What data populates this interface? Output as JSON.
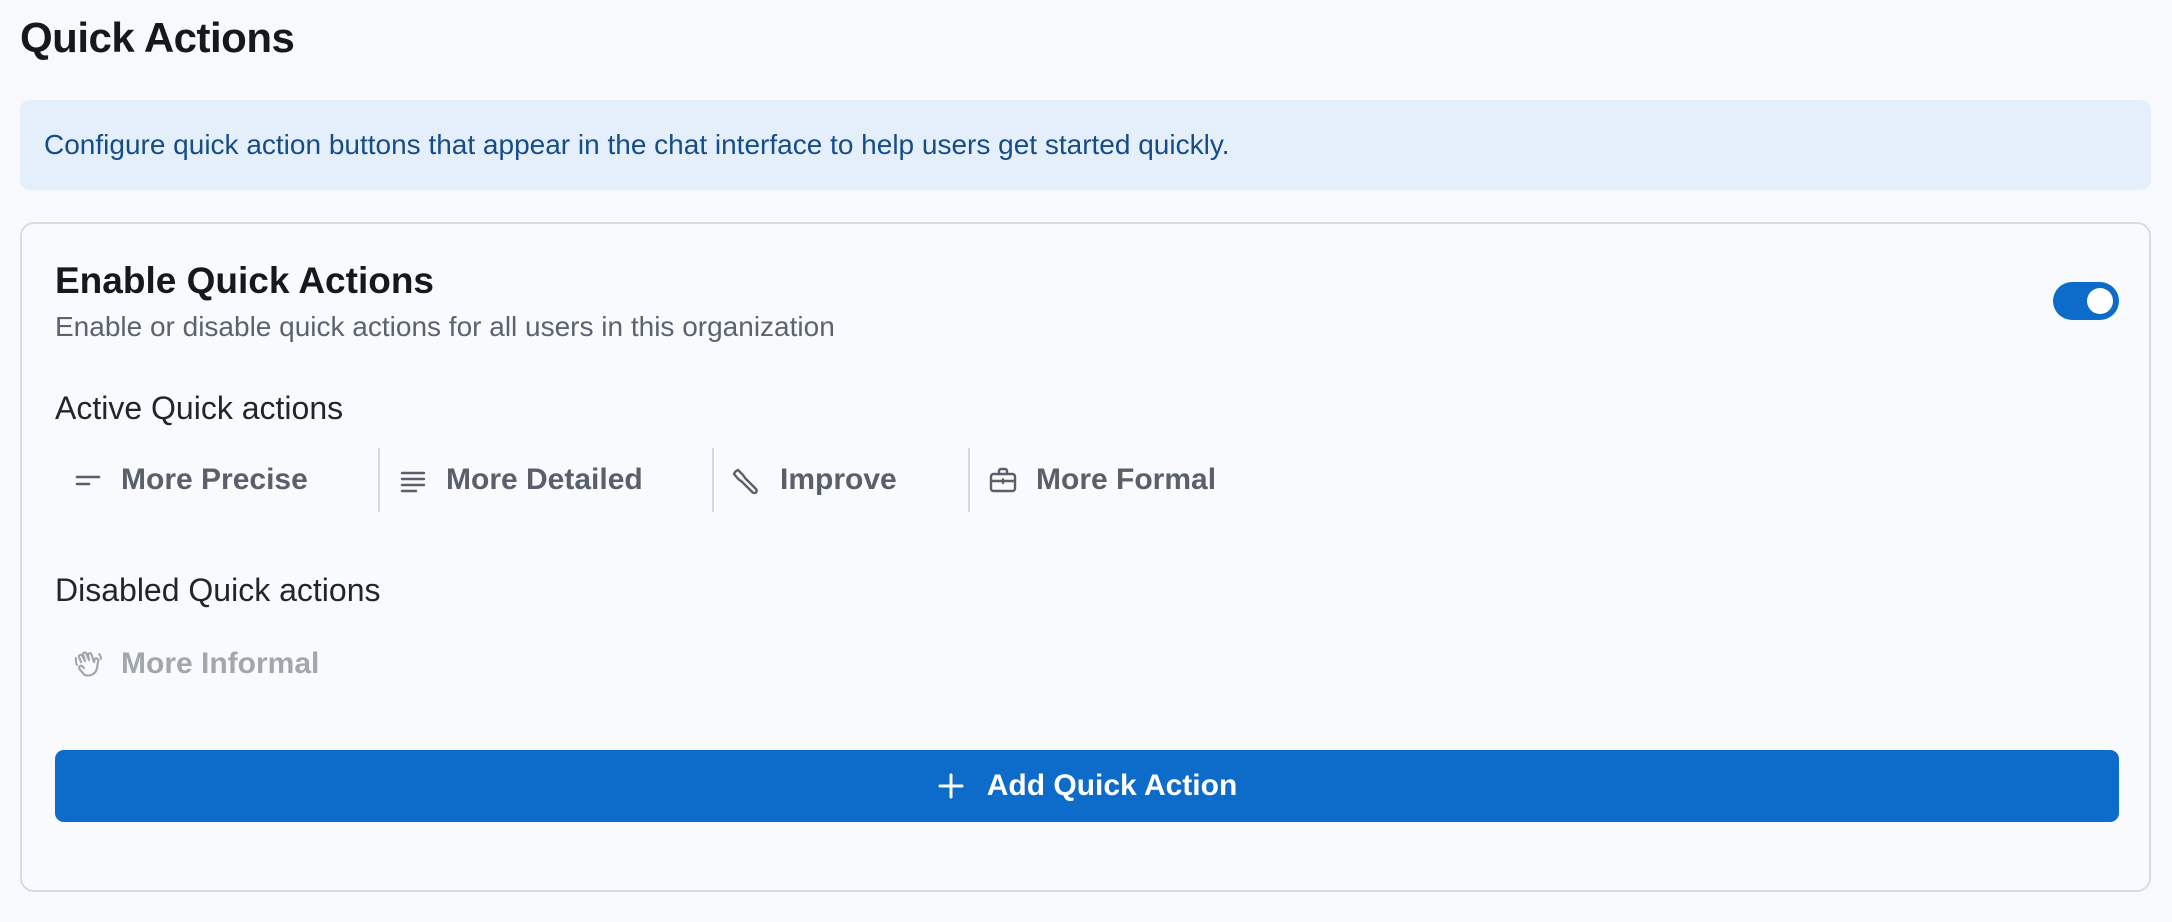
{
  "page": {
    "title": "Quick Actions",
    "info_text": "Configure quick action buttons that appear in the chat interface to help users get started quickly."
  },
  "card": {
    "title": "Enable Quick Actions",
    "subtitle": "Enable or disable quick actions for all users in this organization",
    "toggle_enabled": true,
    "active_label": "Active Quick actions",
    "disabled_label": "Disabled Quick actions",
    "active_actions": [
      {
        "label": "More Precise",
        "icon": "short-lines-icon"
      },
      {
        "label": "More Detailed",
        "icon": "text-lines-icon"
      },
      {
        "label": "Improve",
        "icon": "wrench-icon"
      },
      {
        "label": "More Formal",
        "icon": "briefcase-icon"
      }
    ],
    "disabled_actions": [
      {
        "label": "More Informal",
        "icon": "waving-hand-icon"
      }
    ],
    "add_button_label": "Add Quick Action"
  },
  "colors": {
    "accent": "#0d6bc9",
    "banner_bg": "#e5effb",
    "banner_text": "#154d8a",
    "muted_text": "#59606b",
    "disabled_text": "#a2a7ae"
  }
}
